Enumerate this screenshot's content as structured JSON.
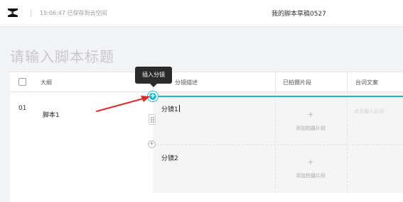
{
  "header": {
    "saved_status": "15:06:47 已保存到云空间",
    "doc_title": "我的脚本草稿0527",
    "logo_icon": "capcut-logo-icon"
  },
  "page": {
    "title_placeholder": "请输入脚本标题"
  },
  "table": {
    "columns": [
      "大纲",
      "分镜描述",
      "已拍摄片段",
      "台词文案"
    ],
    "rows": [
      {
        "number": "01",
        "outline": "脚本1",
        "shots": [
          {
            "description": "分镜1",
            "clip_action": "添加拍摄片段",
            "script_placeholder": "点击输入台词"
          },
          {
            "description": "分镜2",
            "clip_action": "添加拍摄片段"
          }
        ]
      }
    ]
  },
  "tooltip": {
    "insert_shot": "插入分镜"
  },
  "annotation": {
    "arrow_color": "#d92b2b"
  },
  "colors": {
    "accent": "#1fb5c8"
  }
}
